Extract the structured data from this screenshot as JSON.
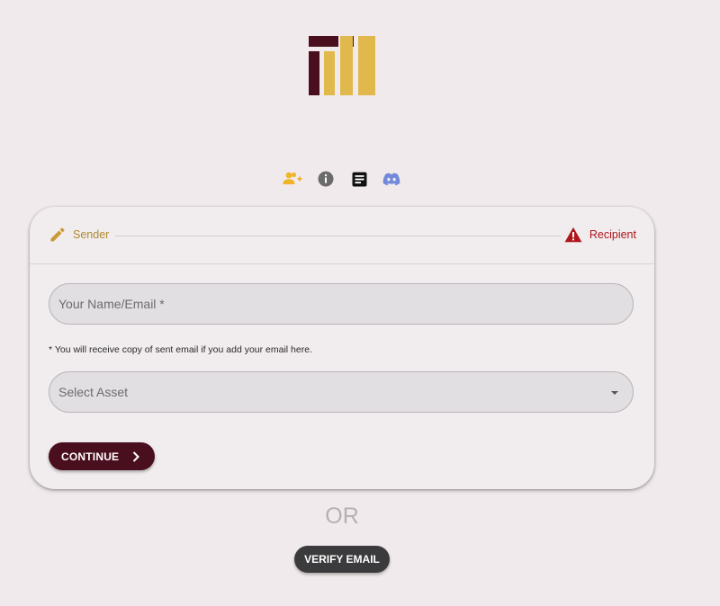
{
  "colors": {
    "background": "#f1eaec",
    "logo_dark": "#4a0f1f",
    "logo_gold": "#e1b84c",
    "sender_accent": "#b08a2e",
    "recipient_accent": "#b0161a",
    "continue_button": "#4a0f1f",
    "verify_button": "#3b3a3c"
  },
  "logo": {
    "icon": "brand-logo"
  },
  "toolbar": {
    "icons": [
      "add-users-icon",
      "info-icon",
      "document-icon",
      "discord-icon"
    ]
  },
  "stepper": {
    "sender_label": "Sender",
    "sender_icon": "pencil-icon",
    "recipient_label": "Recipient",
    "recipient_icon": "warning-icon"
  },
  "form": {
    "name_placeholder": "Your Name/Email *",
    "name_value": "",
    "hint": "* You will receive copy of sent email if you add your email here.",
    "asset_placeholder": "Select Asset",
    "continue_label": "CONTINUE"
  },
  "or_text": "OR",
  "verify_label": "VERIFY EMAIL"
}
